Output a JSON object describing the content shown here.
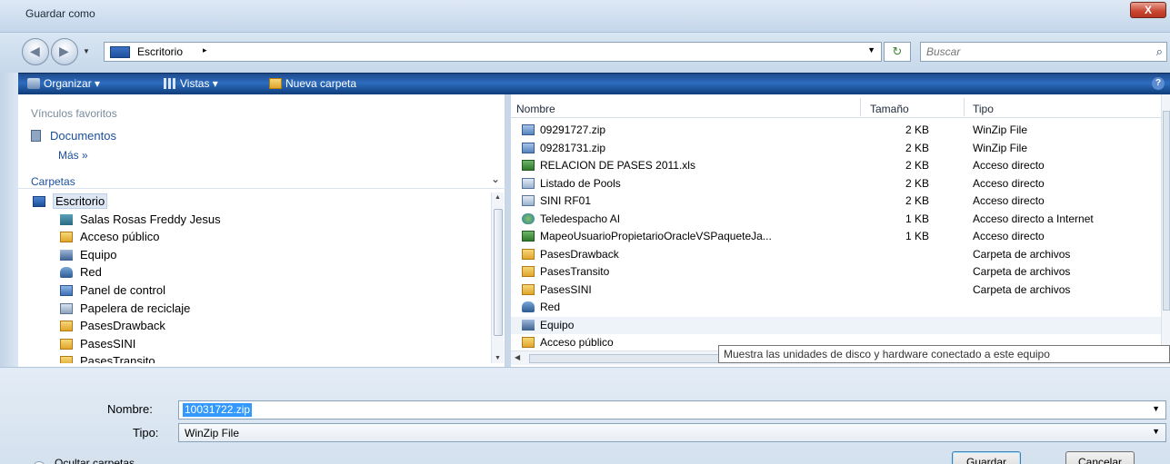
{
  "window": {
    "title": "Guardar como",
    "close_label": "X"
  },
  "address": {
    "crumb": "Escritorio",
    "crumb_arrow": "▸",
    "search_placeholder": "Buscar"
  },
  "toolbar": {
    "organize": "Organizar",
    "views": "Vistas",
    "new_folder": "Nueva carpeta",
    "help": "?"
  },
  "left": {
    "favorites_header": "Vínculos favoritos",
    "favorite_docs": "Documentos",
    "more": "Más »",
    "folders_header": "Carpetas",
    "tree": [
      {
        "label": "Escritorio",
        "icon": "desktop-icon"
      },
      {
        "label": "Salas Rosas Freddy Jesus",
        "icon": "user-folder-icon"
      },
      {
        "label": "Acceso público",
        "icon": "folder-icon"
      },
      {
        "label": "Equipo",
        "icon": "computer-icon"
      },
      {
        "label": "Red",
        "icon": "network-icon"
      },
      {
        "label": "Panel de control",
        "icon": "control-panel-icon"
      },
      {
        "label": "Papelera de reciclaje",
        "icon": "recycle-bin-icon"
      },
      {
        "label": "PasesDrawback",
        "icon": "folder-icon"
      },
      {
        "label": "PasesSINI",
        "icon": "folder-icon"
      },
      {
        "label": "PasesTransito",
        "icon": "folder-icon"
      }
    ]
  },
  "files": {
    "columns": {
      "name": "Nombre",
      "size": "Tamaño",
      "type": "Tipo"
    },
    "rows": [
      {
        "name": "09291727.zip",
        "size": "2 KB",
        "type": "WinZip File",
        "icon": "zip-icon"
      },
      {
        "name": "09281731.zip",
        "size": "2 KB",
        "type": "WinZip File",
        "icon": "zip-icon"
      },
      {
        "name": "RELACION DE PASES 2011.xls",
        "size": "2 KB",
        "type": "Acceso directo",
        "icon": "excel-shortcut-icon"
      },
      {
        "name": "Listado de Pools",
        "size": "2 KB",
        "type": "Acceso directo",
        "icon": "shortcut-icon"
      },
      {
        "name": "SINI RF01",
        "size": "2 KB",
        "type": "Acceso directo",
        "icon": "shortcut-icon"
      },
      {
        "name": "Teledespacho AI",
        "size": "1 KB",
        "type": "Acceso directo a Internet",
        "icon": "internet-shortcut-icon"
      },
      {
        "name": "MapeoUsuarioPropietarioOracleVSPaqueteJa...",
        "size": "1 KB",
        "type": "Acceso directo",
        "icon": "excel-shortcut-icon"
      },
      {
        "name": "PasesDrawback",
        "size": "",
        "type": "Carpeta de archivos",
        "icon": "folder-icon"
      },
      {
        "name": "PasesTransito",
        "size": "",
        "type": "Carpeta de archivos",
        "icon": "folder-icon"
      },
      {
        "name": "PasesSINI",
        "size": "",
        "type": "Carpeta de archivos",
        "icon": "folder-icon"
      },
      {
        "name": "Red",
        "size": "",
        "type": "",
        "icon": "network-icon"
      },
      {
        "name": "Equipo",
        "size": "",
        "type": "",
        "icon": "computer-icon"
      },
      {
        "name": "Acceso público",
        "size": "",
        "type": "",
        "icon": "folder-icon"
      }
    ]
  },
  "tooltip": "Muestra las unidades de disco y hardware conectado a este equipo",
  "form": {
    "name_label": "Nombre:",
    "name_value": "10031722.zip",
    "type_label": "Tipo:",
    "type_value": "WinZip File",
    "hide_folders": "Ocultar carpetas",
    "save": "Guardar",
    "cancel": "Cancelar"
  }
}
